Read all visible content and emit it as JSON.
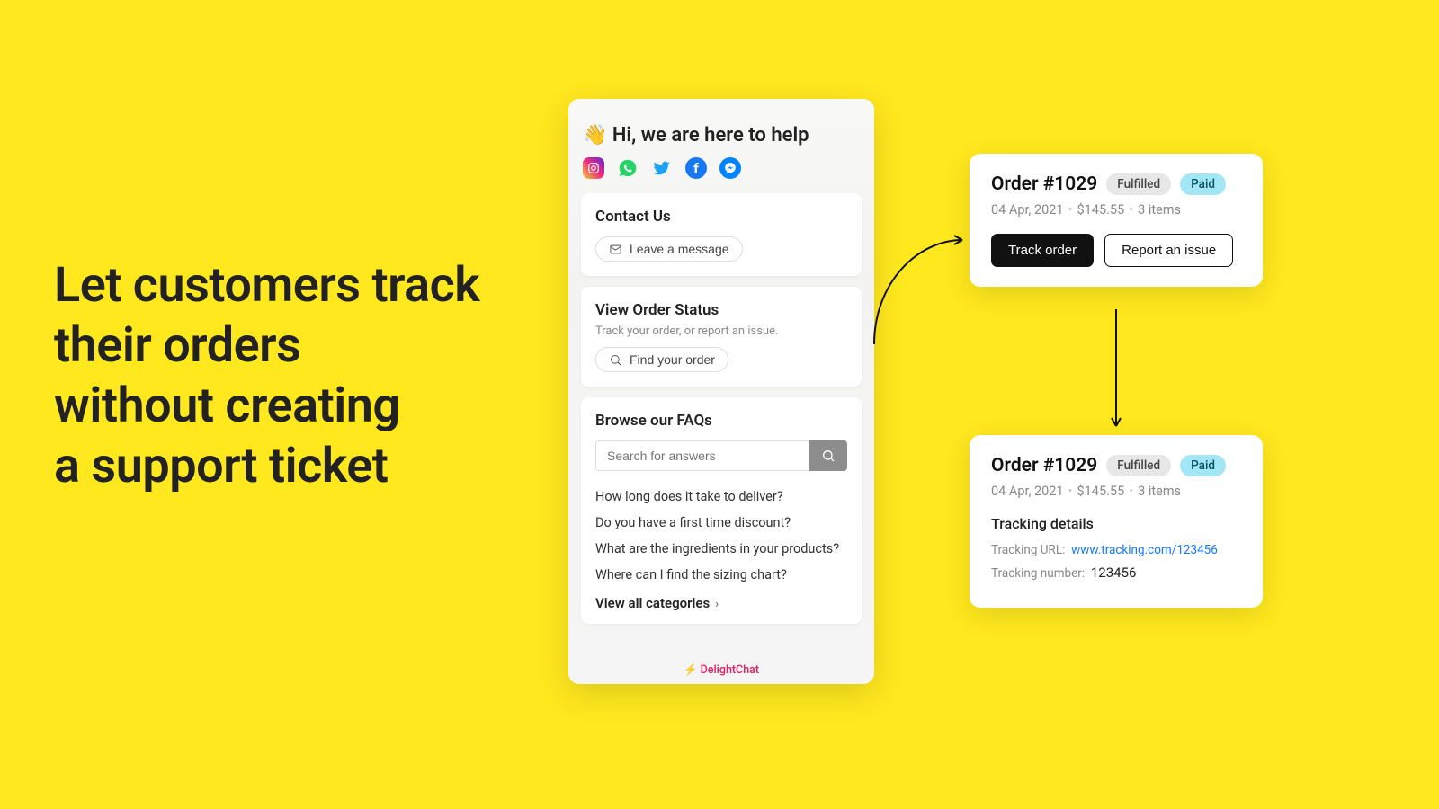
{
  "headline": "Let customers track\ntheir orders\nwithout creating\na support ticket",
  "widget": {
    "greeting": "👋 Hi, we are here to help",
    "contact": {
      "title": "Contact Us",
      "leave_message": "Leave a message"
    },
    "order_status": {
      "title": "View Order Status",
      "subtitle": "Track your order, or report an issue.",
      "find_order": "Find your order"
    },
    "faq": {
      "title": "Browse our FAQs",
      "search_placeholder": "Search for answers",
      "items": [
        "How long does it take to deliver?",
        "Do you have a first time discount?",
        "What are the ingredients in your products?",
        "Where can I find the sizing chart?"
      ],
      "view_all": "View all categories"
    },
    "brand": "DelightChat"
  },
  "order1": {
    "title": "Order #1029",
    "badge1": "Fulfilled",
    "badge2": "Paid",
    "date": "04 Apr, 2021",
    "amount": "$145.55",
    "items": "3 items",
    "track": "Track order",
    "report": "Report an issue"
  },
  "order2": {
    "title": "Order #1029",
    "badge1": "Fulfilled",
    "badge2": "Paid",
    "date": "04 Apr, 2021",
    "amount": "$145.55",
    "items": "3 items",
    "tracking_heading": "Tracking details",
    "url_label": "Tracking URL:",
    "url_value": "www.tracking.com/123456",
    "num_label": "Tracking number:",
    "num_value": "123456"
  }
}
